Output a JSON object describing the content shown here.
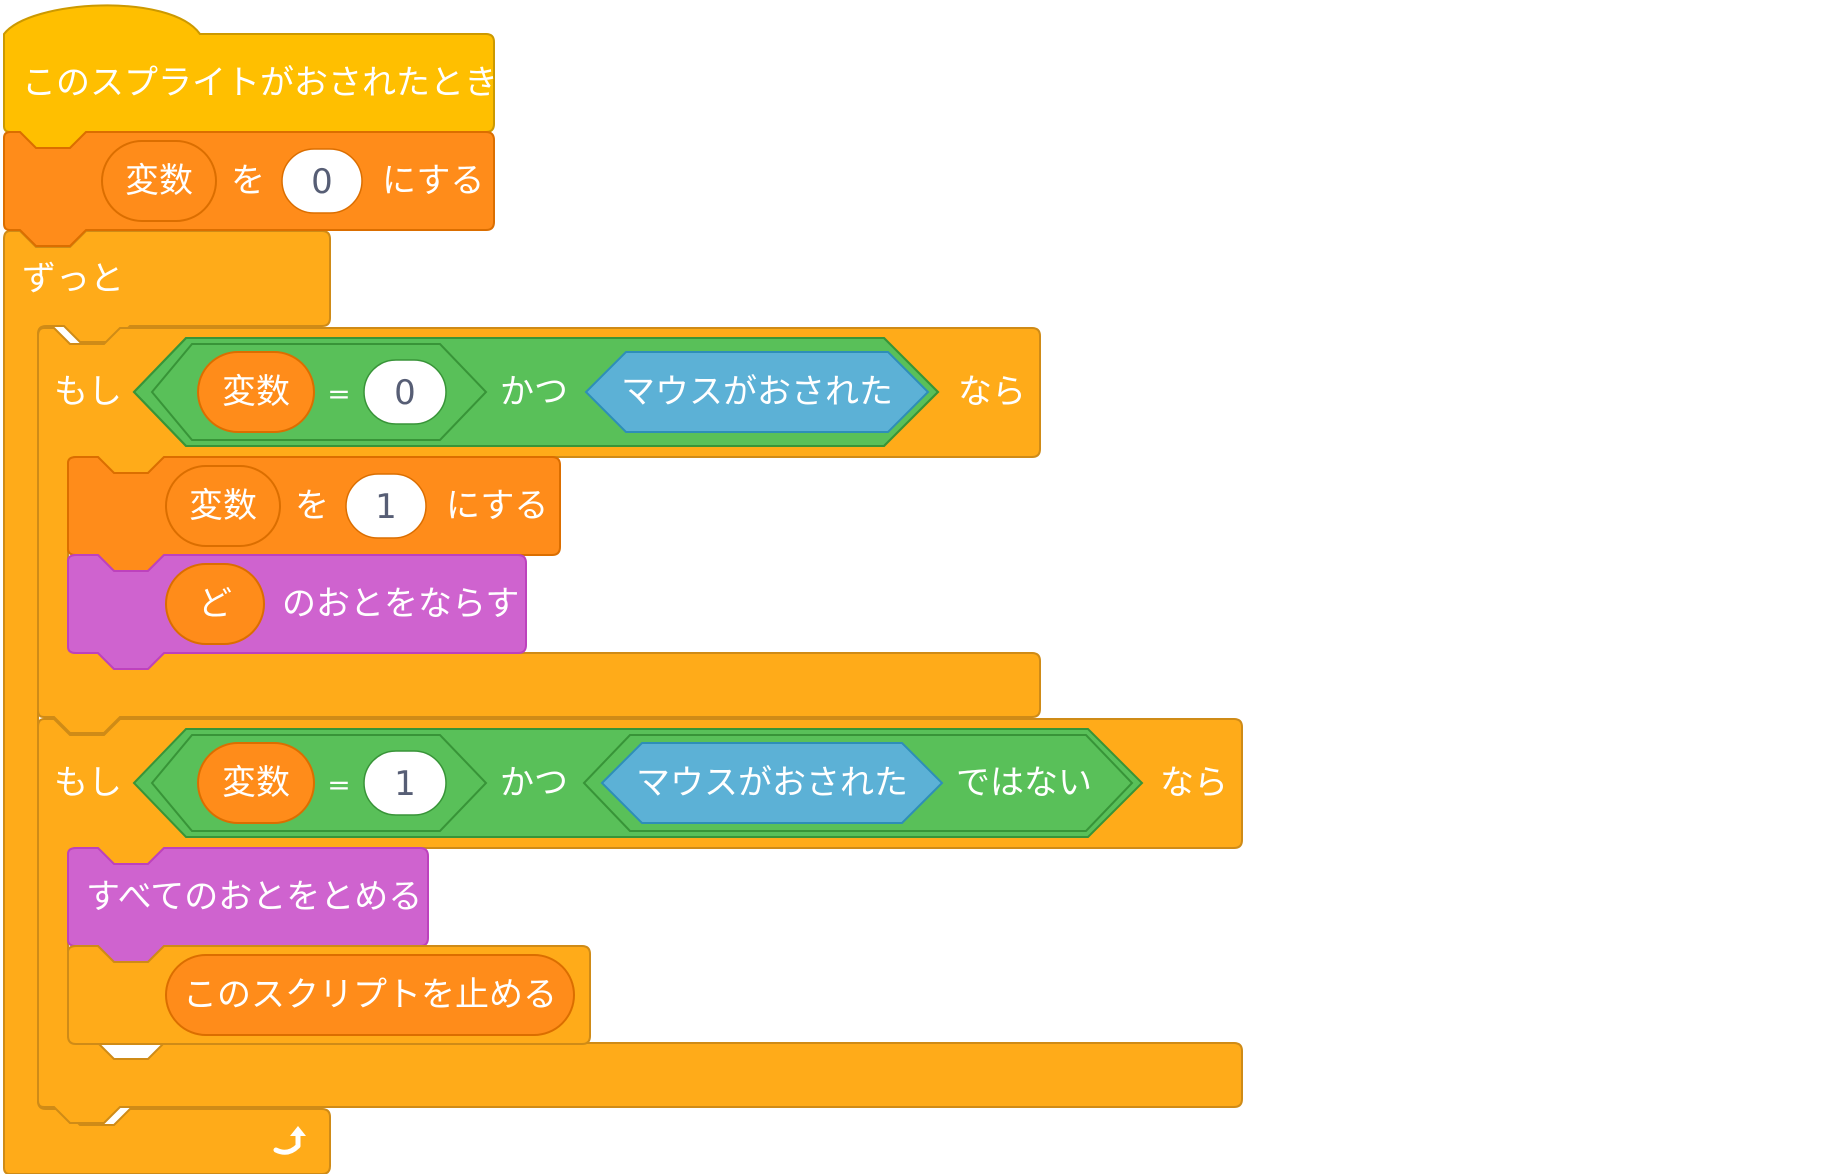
{
  "colors": {
    "events": "#FFBF00",
    "events_stroke": "#CC9900",
    "variables": "#FF8C1A",
    "variables_stroke": "#DB6E00",
    "control": "#FFAB19",
    "control_stroke": "#CF8B17",
    "operators": "#59C059",
    "operators_stroke": "#389438",
    "sensing": "#5CB1D6",
    "sensing_stroke": "#2E8EB8",
    "sound": "#CF63CF",
    "sound_stroke": "#BD42BD",
    "input_bg": "#FFFFFF",
    "input_text": "#575E75"
  },
  "script": {
    "hat": {
      "label": "このスプライトがおされたとき"
    },
    "set_initial": {
      "variable": "変数",
      "word_wo": "を",
      "value": "0",
      "word_nisuru": "にする"
    },
    "forever": {
      "label": "ずっと",
      "loop_arrow_icon": "loop-arrow-icon"
    },
    "if1": {
      "word_moshi": "もし",
      "cond_variable": "変数",
      "cond_equals": "=",
      "cond_value": "0",
      "word_katsu": "かつ",
      "sensing_label": "マウスがおされた",
      "word_nara": "なら",
      "set": {
        "variable": "変数",
        "word_wo": "を",
        "value": "1",
        "word_nisuru": "にする"
      },
      "play_sound": {
        "sound_name": "ど",
        "label": "のおとをならす"
      }
    },
    "if2": {
      "word_moshi": "もし",
      "cond_variable": "変数",
      "cond_equals": "=",
      "cond_value": "1",
      "word_katsu": "かつ",
      "sensing_label": "マウスがおされた",
      "word_not": "ではない",
      "word_nara": "なら",
      "stop_sounds": {
        "label": "すべてのおとをとめる"
      },
      "stop_script": {
        "label": "このスクリプトを止める"
      }
    }
  }
}
